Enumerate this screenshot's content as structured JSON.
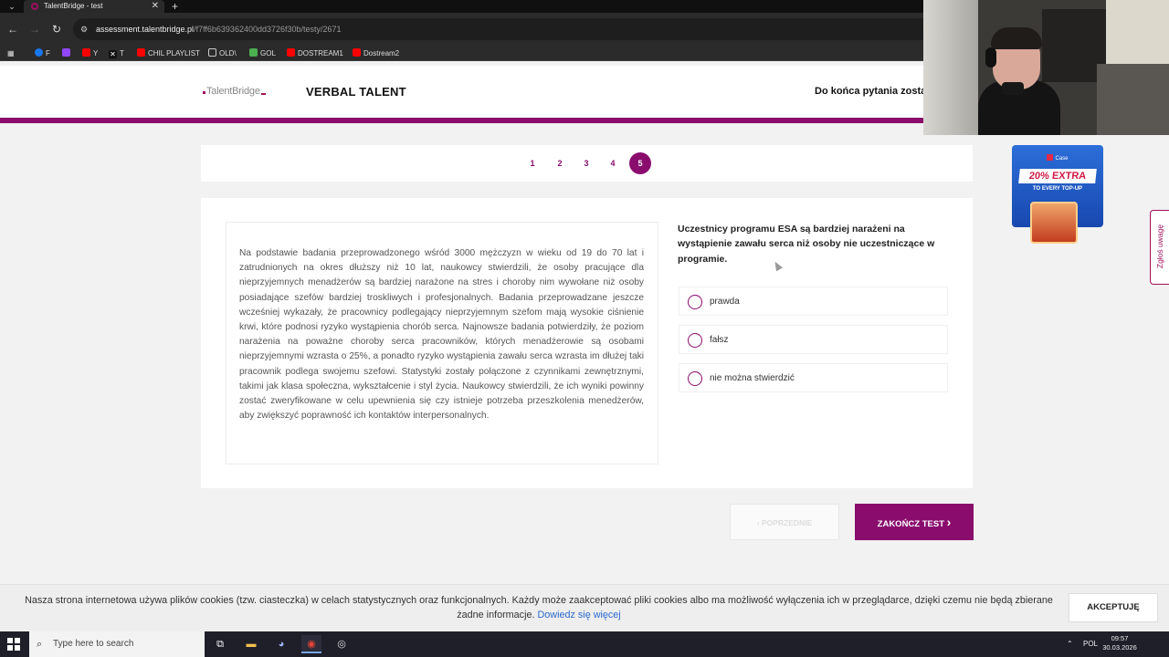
{
  "browser": {
    "tab_title": "TalentBridge - test",
    "tab_close": "✕",
    "new_tab": "+",
    "url_host": "assessment.talentbridge.pl",
    "url_path": "/f7ff6b639362400dd3726f30b/testy/2671",
    "bookmarks": [
      {
        "label": "F",
        "color": "#1877f2"
      },
      {
        "label": "",
        "color": "#9146ff"
      },
      {
        "label": "Y",
        "color": "#ff0000"
      },
      {
        "label": "T",
        "color": "#ffffff"
      },
      {
        "label": "CHIL PLAYLIST",
        "color": "#ff0000"
      },
      {
        "label": "OLD\\",
        "color": "#cccccc"
      },
      {
        "label": "GOL",
        "color": "#4caf50"
      },
      {
        "label": "DOSTREAM1",
        "color": "#ff0000"
      },
      {
        "label": "Dostream2",
        "color": "#ff0000"
      }
    ]
  },
  "header": {
    "logo_text": "TalentBridge",
    "section_title": "VERBAL TALENT",
    "time_label": "Do końca pytania zosta"
  },
  "question_nav": {
    "items": [
      "1",
      "2",
      "3",
      "4",
      "5"
    ],
    "active": "5"
  },
  "passage": "Na podstawie badania przeprowadzonego wśród 3000 mężczyzn w wieku od 19 do 70 lat i zatrudnionych na okres dłuższy niż 10 lat, naukowcy stwierdzili, że osoby pracujące dla nieprzyjemnych menadżerów są bardziej narażone na stres i choroby nim wywołane niż osoby posiadające szefów bardziej troskliwych i profesjonalnych. Badania przeprowadzane jeszcze wcześniej wykazały, że pracownicy podlegający nieprzyjemnym szefom mają wysokie ciśnienie krwi, które podnosi ryzyko wystąpienia chorób serca. Najnowsze badania potwierdziły, że poziom narażenia na poważne choroby serca pracowników, których menadżerowie są osobami nieprzyjemnymi wzrasta o 25%, a ponadto ryzyko wystąpienia zawału serca wzrasta im dłużej taki pracownik podlega swojemu szefowi. Statystyki zostały połączone z czynnikami zewnętrznymi, takimi jak klasa społeczna, wykształcenie i styl życia. Naukowcy stwierdzili, że ich wyniki powinny zostać zweryfikowane w celu upewnienia się czy istnieje potrzeba przeszkolenia menedżerów, aby zwiększyć poprawność ich kontaktów interpersonalnych.",
  "question": "Uczestnicy programu ESA są bardziej narażeni na wystąpienie zawału serca niż osoby nie uczestniczące w programie.",
  "options": [
    "prawda",
    "fałsz",
    "nie można stwierdzić"
  ],
  "buttons": {
    "prev": "POPRZEDNIE",
    "prev_icon": "‹",
    "finish": "ZAKOŃCZ TEST",
    "finish_icon": "›"
  },
  "side_tab": "Zgłoś uwagę",
  "ad": {
    "brand": "Case",
    "headline": "20% EXTRA",
    "subline": "TO EVERY TOP-UP"
  },
  "cookie": {
    "text": "Nasza strona internetowa używa plików cookies (tzw. ciasteczka) w celach statystycznych oraz funkcjonalnych. Każdy może zaakceptować pliki cookies albo ma możliwość wyłączenia ich w przeglądarce, dzięki czemu nie będą zbierane żadne informacje.",
    "link": "Dowiedz się więcej",
    "accept": "AKCEPTUJĘ"
  },
  "taskbar": {
    "search_placeholder": "Type here to search",
    "language": "POL",
    "time": "09:57",
    "date": "30.03.2026"
  },
  "colors": {
    "brand": "#8a0d6e",
    "link": "#2a6ad0"
  }
}
